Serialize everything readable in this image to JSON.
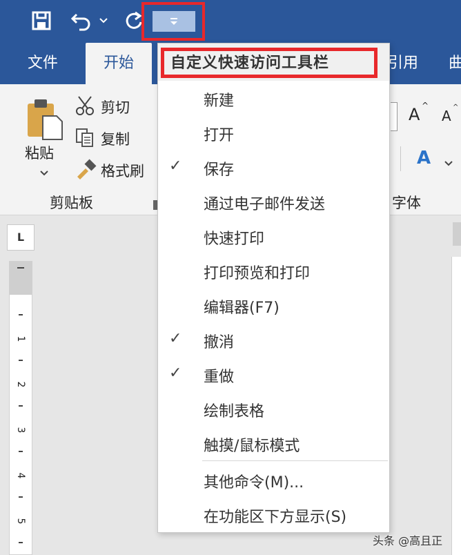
{
  "qat": {
    "save_icon": "save-icon",
    "undo_icon": "undo-icon",
    "redo_icon": "redo-icon",
    "dropdown_icon": "customize-qat-icon"
  },
  "tabs": [
    {
      "label": "文件"
    },
    {
      "label": "开始"
    },
    {
      "label": "引用"
    },
    {
      "label": "曲"
    }
  ],
  "ribbon": {
    "paste_label": "粘贴",
    "cut_label": "剪切",
    "copy_label": "复制",
    "format_painter_label": "格式刷",
    "clipboard_group": "剪贴板",
    "font_group": "字体",
    "grow_font": "A",
    "shrink_font": "A",
    "text_effect": "A"
  },
  "ruler": {
    "corner": "L",
    "numbers": [
      "1",
      "2",
      "3",
      "4",
      "5"
    ]
  },
  "menu": {
    "header": "自定义快速访问工具栏",
    "items": [
      {
        "label": "新建",
        "checked": false
      },
      {
        "label": "打开",
        "checked": false
      },
      {
        "label": "保存",
        "checked": true
      },
      {
        "label": "通过电子邮件发送",
        "checked": false
      },
      {
        "label": "快速打印",
        "checked": false
      },
      {
        "label": "打印预览和打印",
        "checked": false
      },
      {
        "label": "编辑器(F7)",
        "checked": false
      },
      {
        "label": "撤消",
        "checked": true
      },
      {
        "label": "重做",
        "checked": true
      },
      {
        "label": "绘制表格",
        "checked": false
      },
      {
        "label": "触摸/鼠标模式",
        "checked": false
      }
    ],
    "more_commands": "其他命令(M)...",
    "show_below": "在功能区下方显示(S)",
    "check_mark": "✓"
  },
  "watermark": "头条 @高且正",
  "colors": {
    "accent": "#2b579a",
    "highlight_red": "#e8282b"
  }
}
